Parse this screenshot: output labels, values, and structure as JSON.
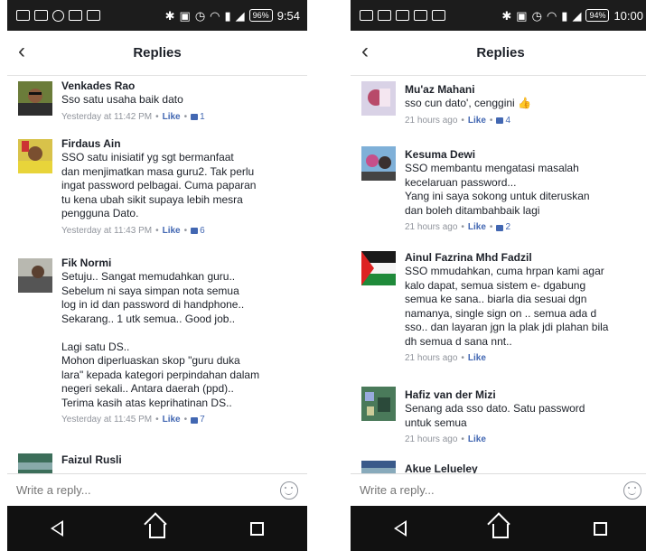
{
  "left": {
    "status": {
      "battery": "96%",
      "time": "9:54"
    },
    "header": {
      "title": "Replies"
    },
    "comments": [
      {
        "name": "Venkades Rao",
        "text": "Sso satu usaha baik dato",
        "time": "Yesterday at 11:42 PM",
        "like": "Like",
        "count": "1"
      },
      {
        "name": "Firdaus Ain",
        "text": "SSO satu inisiatif yg sgt bermanfaat\ndan menjimatkan masa guru2. Tak perlu\ningat password pelbagai. Cuma paparan\ntu kena ubah sikit supaya lebih mesra\npengguna Dato.",
        "time": "Yesterday at 11:43 PM",
        "like": "Like",
        "count": "6"
      },
      {
        "name": "Fik Normi",
        "text": "Setuju.. Sangat memudahkan guru..\nSebelum ni saya simpan nota semua\nlog in id dan password di handphone..\nSekarang.. 1 utk semua.. Good job..\n\nLagi satu DS..\nMohon diperluaskan skop \"guru duka\nlara\" kepada kategori perpindahan dalam\nnegeri sekali.. Antara daerah (ppd)..\nTerima kasih atas keprihatinan DS..",
        "time": "Yesterday at 11:45 PM",
        "like": "Like",
        "count": "7"
      },
      {
        "name": "Faizul Rusli",
        "text": "",
        "time": "",
        "like": "",
        "count": ""
      }
    ],
    "reply": {
      "placeholder": "Write a reply..."
    }
  },
  "right": {
    "status": {
      "battery": "94%",
      "time": "10:00"
    },
    "header": {
      "title": "Replies"
    },
    "comments": [
      {
        "name": "Mu'az Mahani",
        "text": "sso cun dato', cenggini 👍",
        "time": "21 hours ago",
        "like": "Like",
        "count": "4"
      },
      {
        "name": "Kesuma Dewi",
        "text": "SSO membantu mengatasi masalah\nkecelaruan password...\nYang ini saya sokong untuk diteruskan\ndan boleh ditambahbaik lagi",
        "time": "21 hours ago",
        "like": "Like",
        "count": "2"
      },
      {
        "name": "Ainul Fazrina Mhd Fadzil",
        "text": "SSO mmudahkan, cuma hrpan kami agar\nkalo dapat, semua sistem e- dgabung\nsemua ke sana.. biarla dia sesuai dgn\nnamanya, single sign on .. semua ada d\nsso.. dan layaran jgn la plak jdi plahan bila\ndh semua d sana nnt..",
        "time": "21 hours ago",
        "like": "Like",
        "count": ""
      },
      {
        "name": "Hafiz van der Mizi",
        "text": "Senang ada sso dato. Satu password\nuntuk semua",
        "time": "21 hours ago",
        "like": "Like",
        "count": ""
      },
      {
        "name": "Akue Lelueley",
        "text": "",
        "time": "",
        "like": "",
        "count": ""
      }
    ],
    "reply": {
      "placeholder": "Write a reply..."
    }
  }
}
